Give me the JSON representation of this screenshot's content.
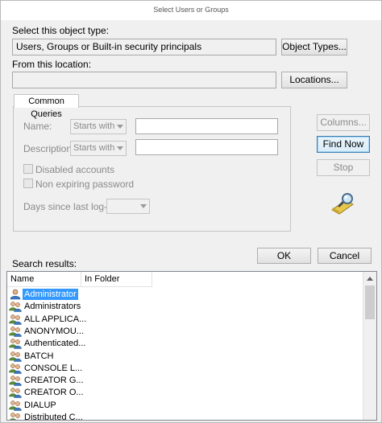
{
  "window": {
    "title": "Select Users or Groups"
  },
  "object_type": {
    "label": "Select this object type:",
    "value": "Users, Groups or Built-in security principals",
    "button": "Object Types..."
  },
  "location": {
    "label": "From this location:",
    "value": "",
    "button": "Locations..."
  },
  "common_queries": {
    "tab": "Common Queries",
    "name_label": "Name:",
    "name_match": "Starts with",
    "description_label": "Description:",
    "description_match": "Starts with",
    "disabled_accounts": "Disabled accounts",
    "non_expiring_password": "Non expiring password",
    "days_label": "Days since last log-on:"
  },
  "side_buttons": {
    "columns": "Columns...",
    "find_now": "Find Now",
    "stop": "Stop"
  },
  "dialog_buttons": {
    "ok": "OK",
    "cancel": "Cancel"
  },
  "results": {
    "label": "Search results:",
    "columns": [
      "Name",
      "In Folder"
    ],
    "rows": [
      {
        "name": "Administrator",
        "icon": "user-icon",
        "selected": true
      },
      {
        "name": "Administrators",
        "icon": "group-icon"
      },
      {
        "name": "ALL APPLICA...",
        "icon": "group-icon"
      },
      {
        "name": "ANONYMOU...",
        "icon": "group-icon"
      },
      {
        "name": "Authenticated...",
        "icon": "group-icon"
      },
      {
        "name": "BATCH",
        "icon": "group-icon"
      },
      {
        "name": "CONSOLE L...",
        "icon": "group-icon"
      },
      {
        "name": "CREATOR G...",
        "icon": "group-icon"
      },
      {
        "name": "CREATOR O...",
        "icon": "group-icon"
      },
      {
        "name": "DIALUP",
        "icon": "group-icon"
      },
      {
        "name": "Distributed C...",
        "icon": "group-icon"
      }
    ]
  },
  "colors": {
    "selection": "#3399ff",
    "focus_border": "#3c7fb1"
  }
}
